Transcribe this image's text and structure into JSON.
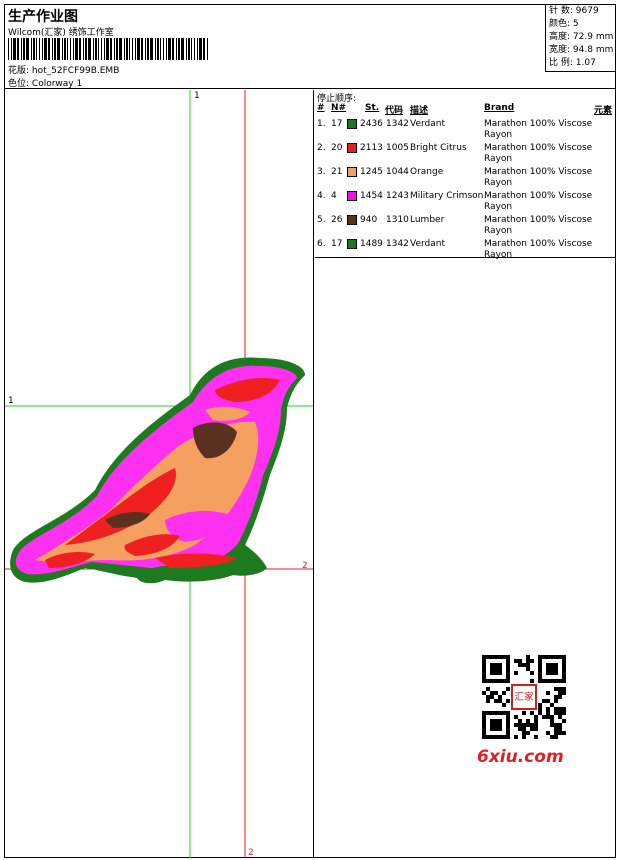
{
  "header": {
    "title": "生产作业图",
    "company": "Wilcom(汇家) 绣饰工作室",
    "design_label": "花版:",
    "design_value": "hot_52FCF99B.EMB",
    "colorway_label": "色位:",
    "colorway_value": "Colorway 1"
  },
  "stats": [
    {
      "label": "针 数:",
      "value": "9679"
    },
    {
      "label": "颜色:",
      "value": "5"
    },
    {
      "label": "高度:",
      "value": "72.9 mm"
    },
    {
      "label": "宽度:",
      "value": "94.8 mm"
    },
    {
      "label": "比 例:",
      "value": "1.07"
    }
  ],
  "stop_order": {
    "title": "停止顺序:",
    "columns": [
      "#",
      "N#",
      "St.",
      "代码",
      "描述",
      "Brand",
      "元素"
    ],
    "rows": [
      {
        "num": "1.",
        "needle": "17",
        "color": "#1a7a1a",
        "st": "2436",
        "code": "1342",
        "desc": "Verdant",
        "brand": "Marathon 100% Viscose Rayon"
      },
      {
        "num": "2.",
        "needle": "20",
        "color": "#e61e1e",
        "st": "2113",
        "code": "1005",
        "desc": "Bright Citrus",
        "brand": "Marathon 100% Viscose Rayon"
      },
      {
        "num": "3.",
        "needle": "21",
        "color": "#f0a060",
        "st": "1245",
        "code": "1044",
        "desc": "Orange",
        "brand": "Marathon 100% Viscose Rayon"
      },
      {
        "num": "4.",
        "needle": "4",
        "color": "#f010e0",
        "st": "1454",
        "code": "1243",
        "desc": "Military Crimson",
        "brand": "Marathon 100% Viscose Rayon"
      },
      {
        "num": "5.",
        "needle": "26",
        "color": "#5a3020",
        "st": "940",
        "code": "1310",
        "desc": "Lumber",
        "brand": "Marathon 100% Viscose Rayon"
      },
      {
        "num": "6.",
        "needle": "17",
        "color": "#1a7a1a",
        "st": "1489",
        "code": "1342",
        "desc": "Verdant",
        "brand": "Marathon 100% Viscose Rayon"
      }
    ]
  },
  "guides": {
    "green_v": "1",
    "green_h": "1",
    "red_v": "2",
    "red_h": "2"
  },
  "watermark": {
    "text": "6xiu.com",
    "seal_text": "汇家"
  }
}
